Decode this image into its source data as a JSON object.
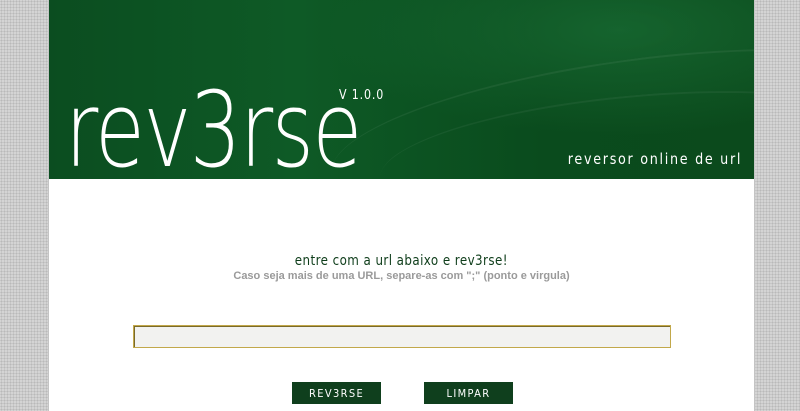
{
  "header": {
    "logo_text": "rev3rse",
    "version": "V 1.0.0",
    "tagline": "reversor online de url"
  },
  "instructions": {
    "main": "entre com a url abaixo e rev3rse!",
    "sub": "Caso seja mais de uma URL, separe-as com \";\" (ponto e virgula)"
  },
  "form": {
    "url_value": "",
    "reverse_label": "REV3RSE",
    "clear_label": "LIMPAR"
  },
  "colors": {
    "header_green": "#0b4d20",
    "button_green": "#0f3f1d",
    "input_border": "#c2a84a"
  }
}
